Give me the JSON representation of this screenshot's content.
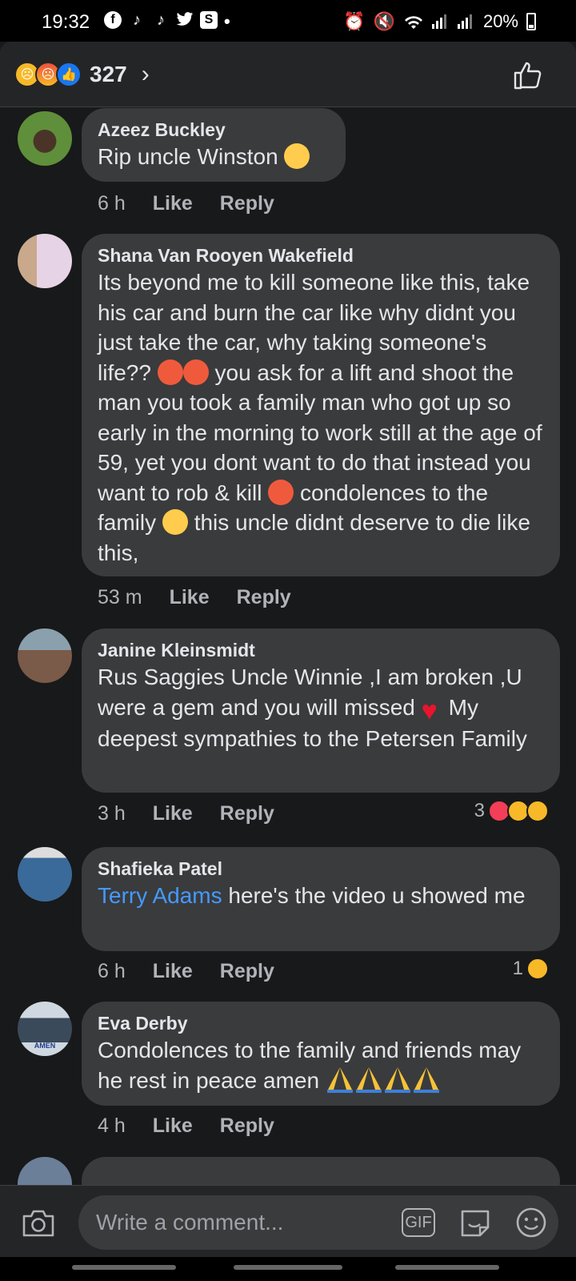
{
  "status_bar": {
    "time": "19:32",
    "app_icons": [
      "facebook-icon",
      "tiktok-icon",
      "tiktok-icon",
      "twitter-icon",
      "s-app-icon"
    ],
    "battery": "20%"
  },
  "reactions_header": {
    "count": "327",
    "chevron": "›"
  },
  "comments": [
    {
      "author": "Azeez Buckley",
      "text": "Rip uncle Winston",
      "time": "6 h",
      "like": "Like",
      "reply": "Reply"
    },
    {
      "author": "Shana Van Rooyen Wakefield",
      "text_1": "Its beyond me to kill someone like this, take his car and burn the car like why didnt you just take the car, why taking someone's life??",
      "text_2": "you ask for a lift and shoot the man you took a family man who got up so early in the morning to work still at the age of 59, yet you dont want to do that instead you want to rob & kill",
      "text_3": "condolences to the family",
      "text_4": "this uncle didnt deserve to die like this,",
      "time": "53 m",
      "like": "Like",
      "reply": "Reply"
    },
    {
      "author": "Janine Kleinsmidt",
      "text_1": "Rus Saggies Uncle Winnie ,I am broken ,U were a gem and you will missed",
      "text_2": "My deepest sympathies to the Petersen Family",
      "time": "3 h",
      "like": "Like",
      "reply": "Reply",
      "reaction_count": "3"
    },
    {
      "author": "Shafieka Patel",
      "mention": "Terry Adams",
      "text": " here's the video u showed me",
      "time": "6 h",
      "like": "Like",
      "reply": "Reply",
      "reaction_count": "1"
    },
    {
      "author": "Eva Derby",
      "text": "Condolences to the family and friends may he rest in peace amen",
      "time": "4 h",
      "like": "Like",
      "reply": "Reply",
      "avatar_caption": "AMEN"
    }
  ],
  "composer": {
    "placeholder": "Write a comment...",
    "gif_label": "GIF"
  },
  "colors": {
    "background": "#18191a",
    "bubble": "#3a3b3c",
    "mention": "#4599ff",
    "secondary_text": "#b0b3b8"
  }
}
